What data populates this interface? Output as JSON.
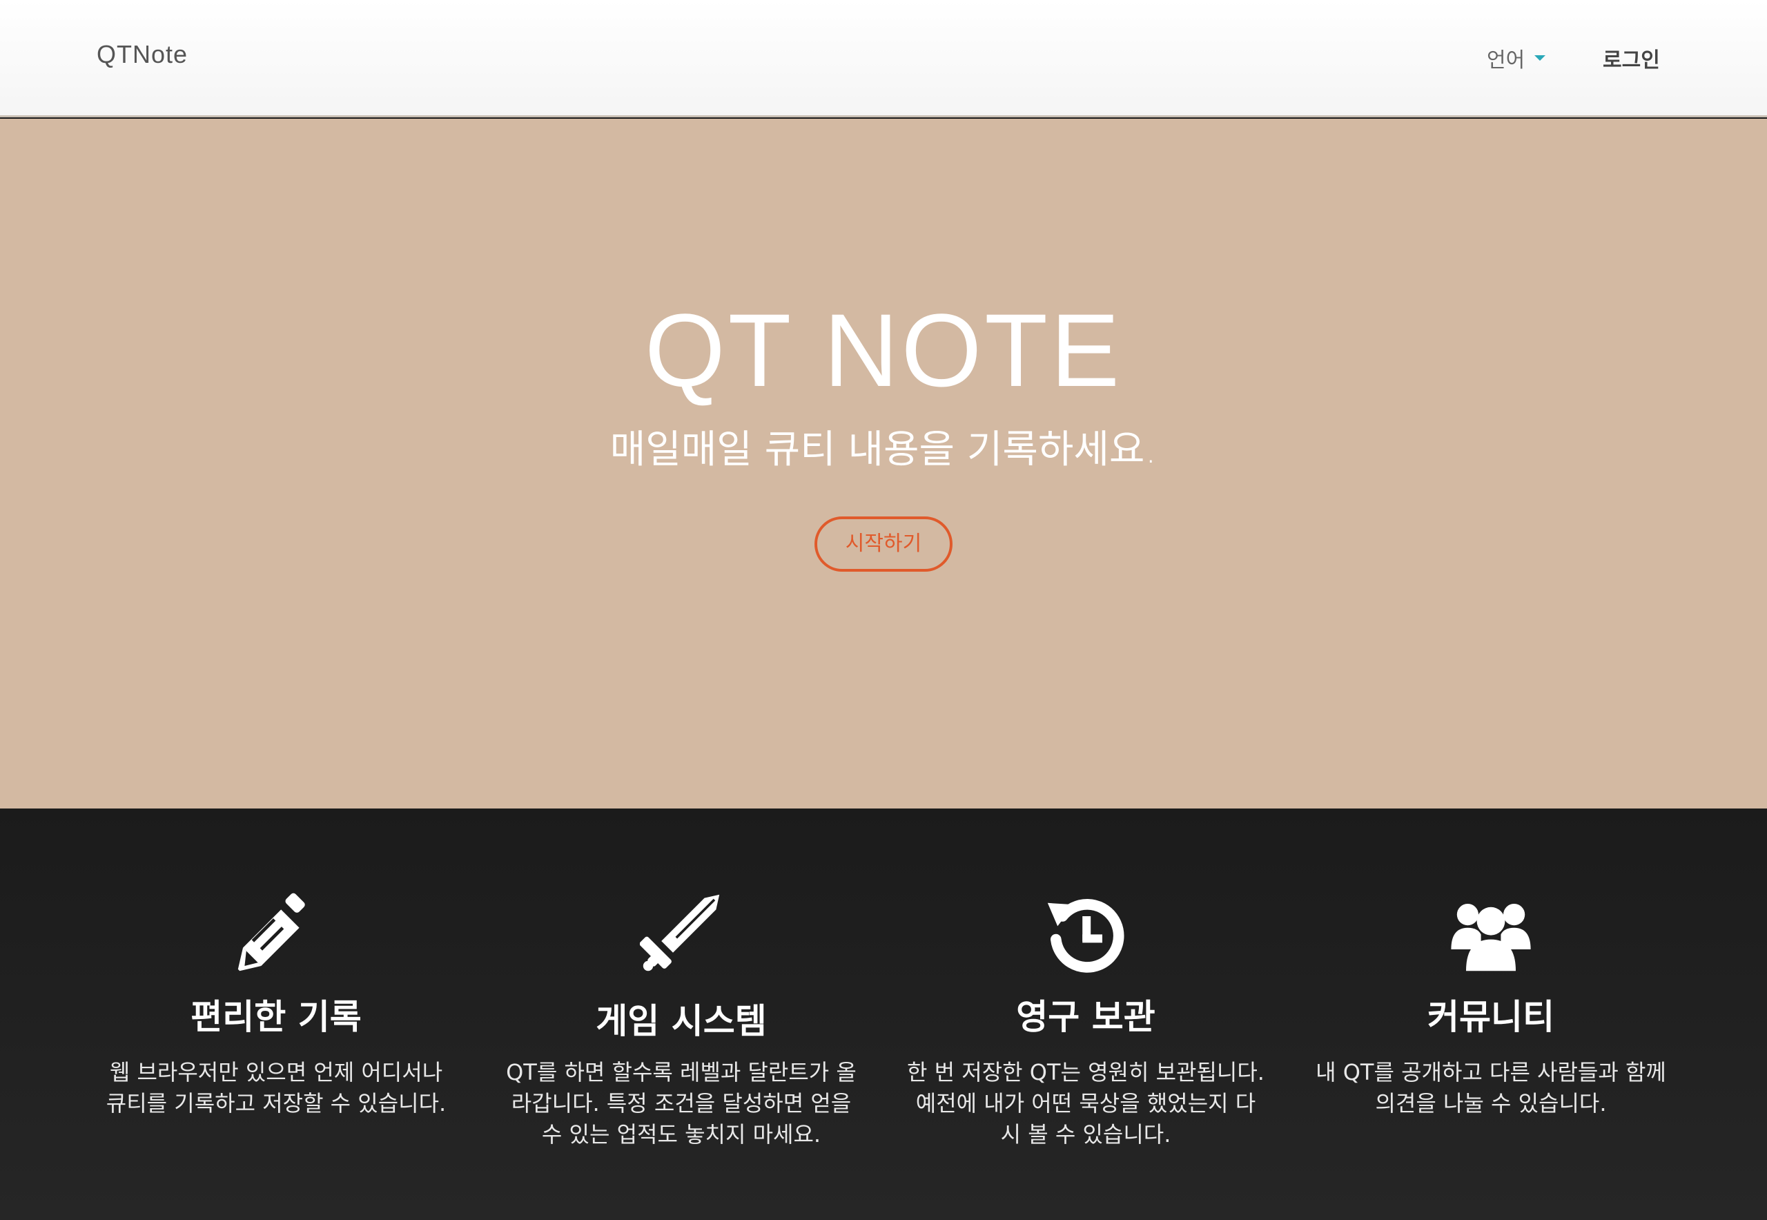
{
  "navbar": {
    "brand": "QTNote",
    "language_label": "언어",
    "login_label": "로그인"
  },
  "hero": {
    "title": "QT NOTE",
    "subtitle": "매일매일 큐티 내용을 기록하세요.",
    "cta_label": "시작하기"
  },
  "features": [
    {
      "icon": "pencil-icon",
      "title": "편리한 기록",
      "description": "웹 브라우저만 있으면 언제 어디서나 큐티를 기록하고 저장할 수 있습니다."
    },
    {
      "icon": "sword-icon",
      "title": "게임 시스템",
      "description": "QT를 하면 할수록 레벨과 달란트가 올라갑니다. 특정 조건을 달성하면 얻을 수 있는 업적도 놓치지 마세요."
    },
    {
      "icon": "history-icon",
      "title": "영구 보관",
      "description": "한 번 저장한 QT는 영원히 보관됩니다. 예전에 내가 어떤 묵상을 했었는지 다시 볼 수 있습니다."
    },
    {
      "icon": "users-icon",
      "title": "커뮤니티",
      "description": "내 QT를 공개하고 다른 사람들과 함께 의견을 나눌 수 있습니다."
    }
  ],
  "colors": {
    "hero_background": "#d3b9a2",
    "cta_accent": "#e05a2b",
    "caret_accent": "#2aa8b8",
    "features_background": "#1e1e1e"
  }
}
